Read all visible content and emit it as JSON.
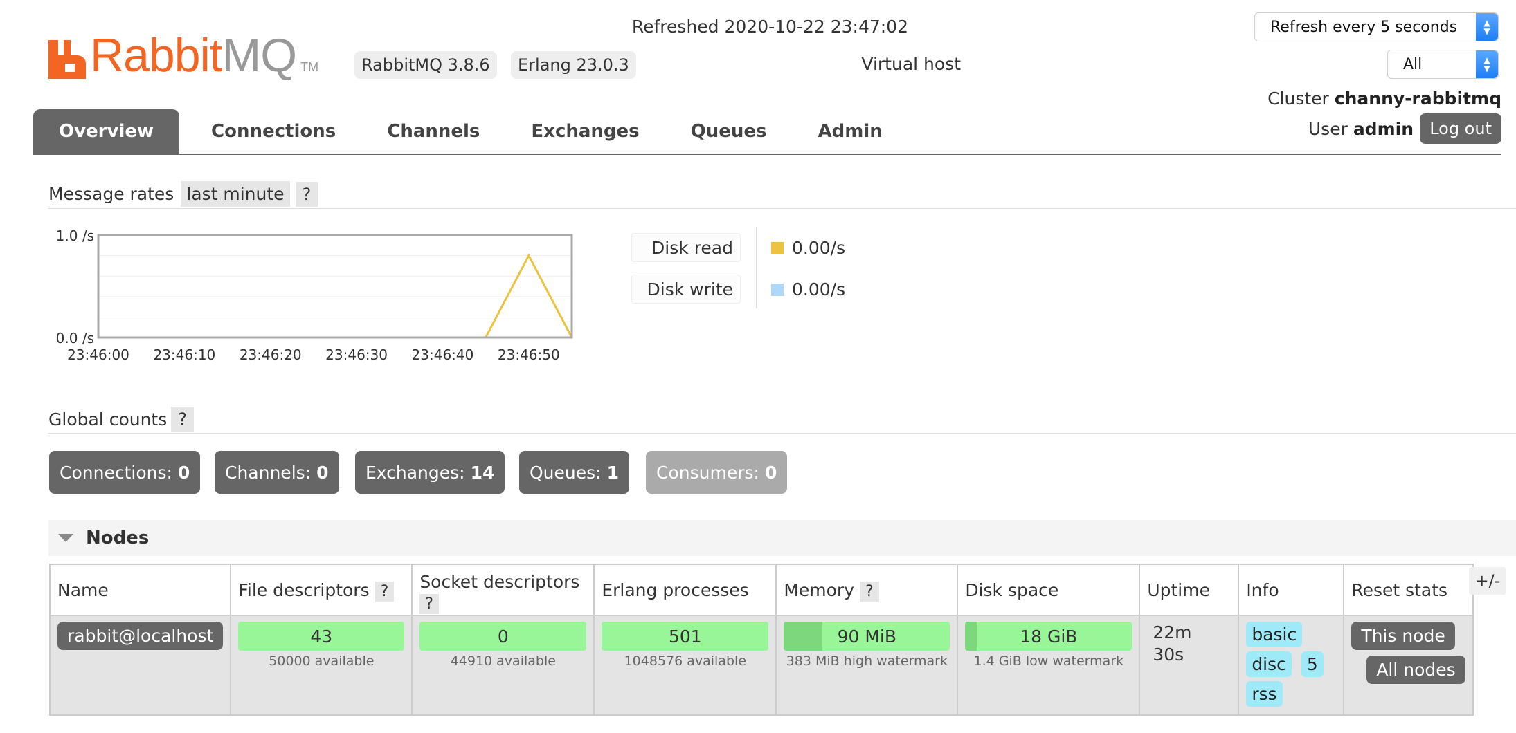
{
  "header": {
    "logo_rabbit": "Rabbit",
    "logo_mq": "MQ",
    "logo_tm": "TM",
    "rabbitmq_version": "RabbitMQ 3.8.6",
    "erlang_version": "Erlang 23.0.3",
    "refreshed": "Refreshed 2020-10-22 23:47:02",
    "refresh_select": "Refresh every 5 seconds",
    "vhost_label": "Virtual host",
    "vhost_value": "All",
    "cluster_label": "Cluster",
    "cluster_name": "channy-rabbitmq",
    "user_label": "User",
    "user_name": "admin",
    "logout_label": "Log out"
  },
  "tabs": [
    "Overview",
    "Connections",
    "Channels",
    "Exchanges",
    "Queues",
    "Admin"
  ],
  "message_rates": {
    "title": "Message rates",
    "range": "last minute",
    "help": "?"
  },
  "chart_data": {
    "type": "line",
    "x": [
      "23:46:00",
      "23:46:05",
      "23:46:10",
      "23:46:15",
      "23:46:20",
      "23:46:25",
      "23:46:30",
      "23:46:35",
      "23:46:40",
      "23:46:45",
      "23:46:50",
      "23:46:55"
    ],
    "series": [
      {
        "name": "Disk read",
        "values": [
          0,
          0,
          0,
          0,
          0,
          0,
          0,
          0,
          0,
          0,
          0.8,
          0
        ],
        "color": "#edc240"
      },
      {
        "name": "Disk write",
        "values": [
          0,
          0,
          0,
          0,
          0,
          0,
          0,
          0,
          0,
          0,
          0,
          0
        ],
        "color": "#afd8f8"
      }
    ],
    "xticks": [
      "23:46:00",
      "23:46:10",
      "23:46:20",
      "23:46:30",
      "23:46:40",
      "23:46:50"
    ],
    "yticks": [
      "0.0 /s",
      "1.0 /s"
    ],
    "ylim": [
      0,
      1
    ],
    "grid": true,
    "legend": "right"
  },
  "legend": [
    {
      "label": "Disk read",
      "value": "0.00/s",
      "color": "#edc240"
    },
    {
      "label": "Disk write",
      "value": "0.00/s",
      "color": "#afd8f8"
    }
  ],
  "global_counts": {
    "title": "Global counts",
    "help": "?",
    "items": [
      {
        "label": "Connections:",
        "value": "0"
      },
      {
        "label": "Channels:",
        "value": "0"
      },
      {
        "label": "Exchanges:",
        "value": "14"
      },
      {
        "label": "Queues:",
        "value": "1"
      },
      {
        "label": "Consumers:",
        "value": "0"
      }
    ]
  },
  "nodes": {
    "title": "Nodes",
    "plus_minus": "+/-",
    "columns": [
      "Name",
      "File descriptors",
      "Socket descriptors",
      "Erlang processes",
      "Memory",
      "Disk space",
      "Uptime",
      "Info",
      "Reset stats"
    ],
    "help": "?",
    "row": {
      "name": "rabbit@localhost",
      "file_descriptors": {
        "value": "43",
        "sub": "50000 available"
      },
      "socket_descriptors": {
        "value": "0",
        "sub": "44910 available"
      },
      "erlang_processes": {
        "value": "501",
        "sub": "1048576 available"
      },
      "memory": {
        "value": "90 MiB",
        "sub": "383 MiB high watermark",
        "fill_fraction": 0.23
      },
      "disk_space": {
        "value": "18 GiB",
        "sub": "1.4 GiB low watermark",
        "fill_fraction": 0.07
      },
      "uptime_line1": "22m",
      "uptime_line2": "30s",
      "info_tags": [
        "basic",
        "disc",
        "5",
        "rss"
      ],
      "reset_this_node": "This node",
      "reset_all_nodes": "All nodes"
    }
  }
}
